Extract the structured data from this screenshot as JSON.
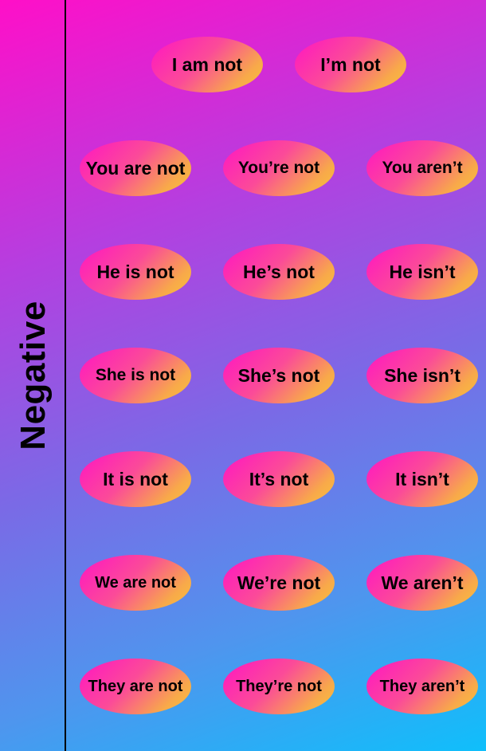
{
  "side_label": "Negative",
  "rows": [
    {
      "forms": [
        "I am not",
        "I’m not"
      ]
    },
    {
      "forms": [
        "You are not",
        "You’re not",
        "You aren’t"
      ]
    },
    {
      "forms": [
        "He is not",
        "He’s not",
        "He isn’t"
      ]
    },
    {
      "forms": [
        "She is not",
        "She’s not",
        "She isn’t"
      ]
    },
    {
      "forms": [
        "It is not",
        "It’s not",
        "It isn’t"
      ]
    },
    {
      "forms": [
        "We are not",
        "We’re not",
        "We aren’t"
      ]
    },
    {
      "forms": [
        "They are not",
        "They’re not",
        "They aren’t"
      ]
    }
  ],
  "colors": {
    "background_start": "#ff0fc8",
    "background_end": "#0fbffb",
    "pill_start": "#ff14c4",
    "pill_end": "#f6c33a",
    "text": "#000000"
  }
}
